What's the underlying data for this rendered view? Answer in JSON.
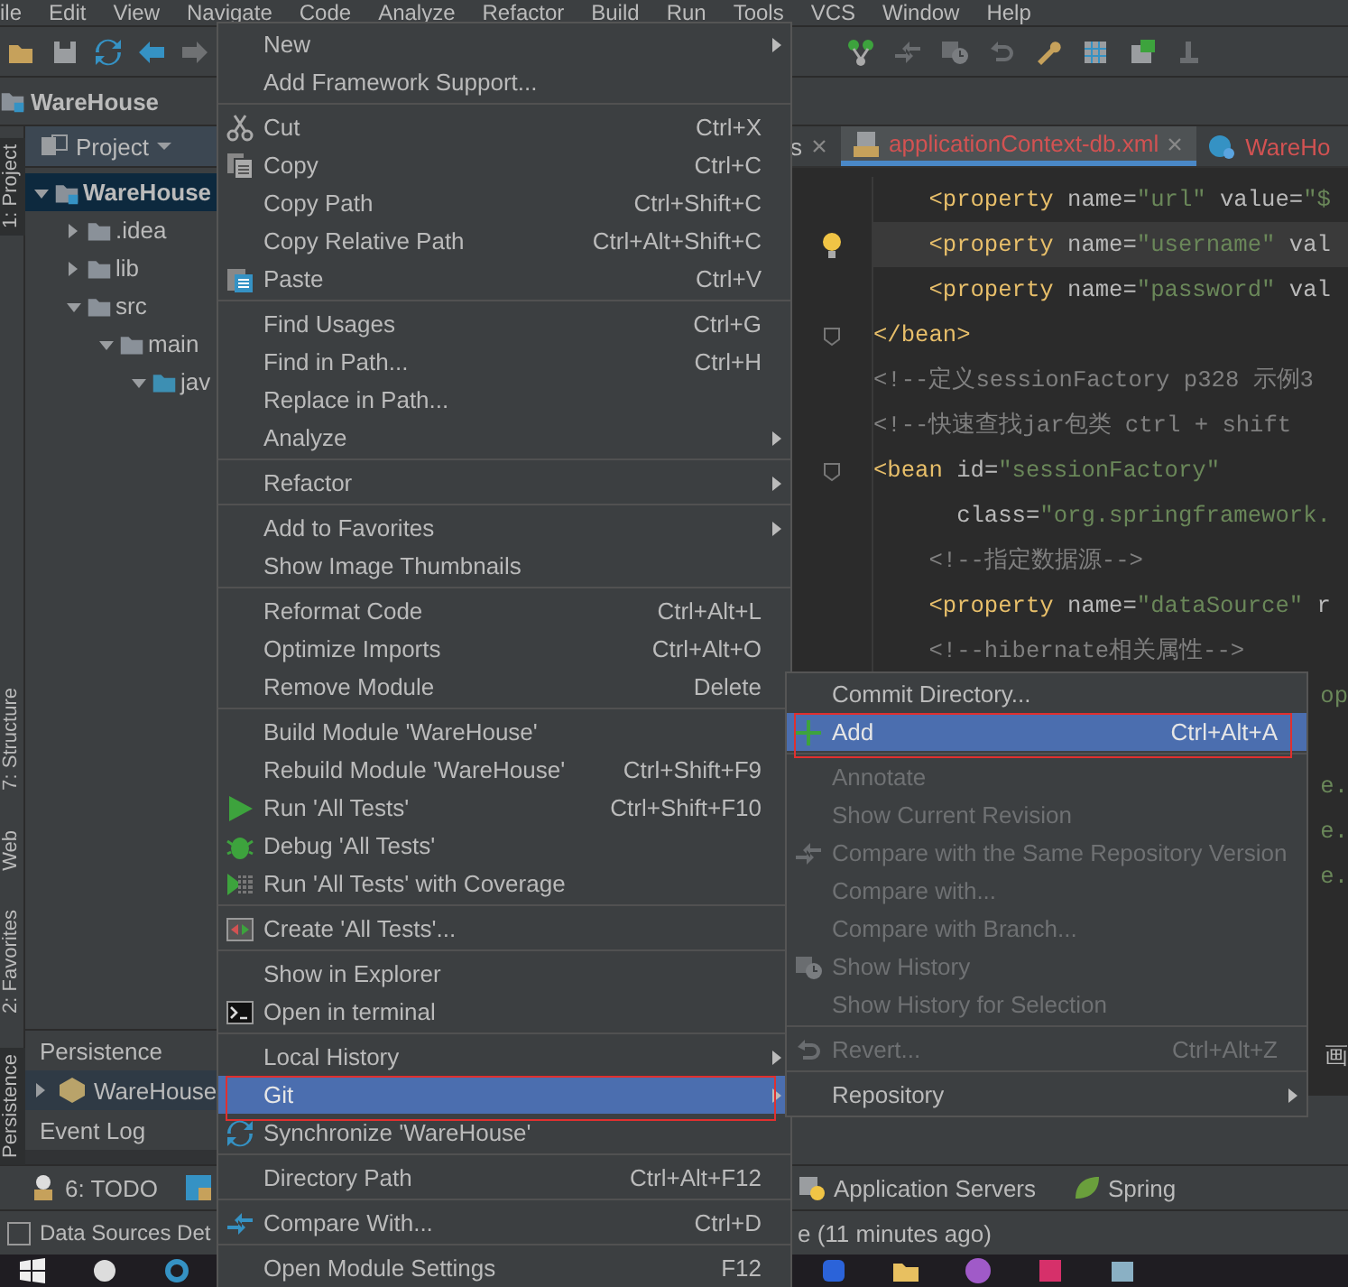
{
  "menu_bar": [
    "ile",
    "Edit",
    "View",
    "Navigate",
    "Code",
    "Analyze",
    "Refactor",
    "Build",
    "Run",
    "Tools",
    "VCS",
    "Window",
    "Help"
  ],
  "breadcrumb": {
    "label": "WareHouse"
  },
  "left_stripe": [
    {
      "label": "1: Project",
      "selected": true
    },
    {
      "label": "7: Structure",
      "selected": false
    },
    {
      "label": "Web",
      "selected": false
    },
    {
      "label": "2: Favorites",
      "selected": false
    },
    {
      "label": "Persistence",
      "selected": true
    }
  ],
  "project_panel": {
    "title": "Project",
    "tree": [
      {
        "label": "WareHouse",
        "expanded": true,
        "selected": true,
        "children": [
          {
            "label": ".idea",
            "expanded": false,
            "selected": false
          },
          {
            "label": "lib",
            "expanded": false,
            "selected": false
          },
          {
            "label": "src",
            "expanded": true,
            "selected": false,
            "children": [
              {
                "label": "main",
                "expanded": true,
                "selected": false,
                "children": [
                  {
                    "label": "jav",
                    "expanded": true,
                    "selected": false
                  }
                ]
              }
            ]
          }
        ]
      }
    ]
  },
  "persistence_panel": {
    "title": "Persistence",
    "items": [
      {
        "label": "WareHouse",
        "expanded": false
      }
    ],
    "footer": "Event Log"
  },
  "editor": {
    "tabs": [
      {
        "label": "s",
        "selected": false
      },
      {
        "label": "applicationContext-db.xml",
        "selected": true
      },
      {
        "label": "WareHo",
        "selected": false
      }
    ],
    "lines": [
      {
        "kind": "code",
        "highlighted": false,
        "tokens": [
          {
            "kind": "tag",
            "text": "    <property"
          },
          {
            "kind": "attr",
            "text": " name="
          },
          {
            "kind": "value",
            "text": "\"url\""
          },
          {
            "kind": "attr",
            "text": " value="
          },
          {
            "kind": "value",
            "text": "\"$"
          }
        ]
      },
      {
        "kind": "code",
        "highlighted": true,
        "tokens": [
          {
            "kind": "tag",
            "text": "    <property"
          },
          {
            "kind": "attr",
            "text": " name="
          },
          {
            "kind": "value",
            "text": "\"username\""
          },
          {
            "kind": "attr",
            "text": " val"
          }
        ]
      },
      {
        "kind": "code",
        "highlighted": false,
        "tokens": [
          {
            "kind": "tag",
            "text": "    <property"
          },
          {
            "kind": "attr",
            "text": " name="
          },
          {
            "kind": "value",
            "text": "\"password\""
          },
          {
            "kind": "attr",
            "text": " val"
          }
        ]
      },
      {
        "kind": "code",
        "highlighted": false,
        "tokens": [
          {
            "kind": "tag",
            "text": "</bean>"
          }
        ]
      },
      {
        "kind": "code",
        "highlighted": false,
        "tokens": [
          {
            "kind": "comment",
            "text": "<!--定义sessionFactory p328 示例3"
          }
        ]
      },
      {
        "kind": "code",
        "highlighted": false,
        "tokens": [
          {
            "kind": "comment",
            "text": "<!--快速查找jar包类 ctrl + shift"
          }
        ]
      },
      {
        "kind": "code",
        "highlighted": false,
        "tokens": [
          {
            "kind": "tag",
            "text": "<bean"
          },
          {
            "kind": "attr",
            "text": " id="
          },
          {
            "kind": "value",
            "text": "\"sessionFactory\""
          }
        ]
      },
      {
        "kind": "code",
        "highlighted": false,
        "tokens": [
          {
            "kind": "attr",
            "text": "      class="
          },
          {
            "kind": "value",
            "text": "\"org.springframework."
          }
        ]
      },
      {
        "kind": "code",
        "highlighted": false,
        "tokens": [
          {
            "kind": "comment",
            "text": "    <!--指定数据源-->"
          }
        ]
      },
      {
        "kind": "code",
        "highlighted": false,
        "tokens": [
          {
            "kind": "tag",
            "text": "    <property"
          },
          {
            "kind": "attr",
            "text": " name="
          },
          {
            "kind": "value",
            "text": "\"dataSource\""
          },
          {
            "kind": "attr",
            "text": " r"
          }
        ]
      },
      {
        "kind": "code",
        "highlighted": false,
        "tokens": [
          {
            "kind": "comment",
            "text": "    <!--hibernate相关属性-->"
          }
        ]
      },
      {
        "kind": "fragment",
        "tokens": [
          {
            "kind": "value",
            "text": "op"
          }
        ]
      },
      {
        "kind": "blank"
      },
      {
        "kind": "fragment",
        "tokens": [
          {
            "kind": "value",
            "text": "e."
          }
        ]
      },
      {
        "kind": "fragment",
        "tokens": [
          {
            "kind": "value",
            "text": "e."
          }
        ]
      },
      {
        "kind": "fragment",
        "tokens": [
          {
            "kind": "value",
            "text": "e."
          }
        ]
      },
      {
        "kind": "blank"
      },
      {
        "kind": "blank"
      },
      {
        "kind": "blank"
      },
      {
        "kind": "fragment",
        "tokens": [
          {
            "kind": "attr",
            "text": "画"
          }
        ]
      }
    ]
  },
  "bottom_tabs": {
    "left": [
      {
        "label": "6: TODO"
      }
    ],
    "right": [
      {
        "label": "Application Servers"
      },
      {
        "label": "Spring"
      }
    ]
  },
  "status_bar": {
    "left": "Data Sources Det",
    "right": "e (11 minutes ago)"
  },
  "context_menu": {
    "items": [
      {
        "kind": "item",
        "label": "New",
        "submenu": true,
        "selected": false
      },
      {
        "kind": "item",
        "label": "Add Framework Support...",
        "selected": false
      },
      {
        "kind": "separator"
      },
      {
        "kind": "item",
        "label": "Cut",
        "shortcut": "Ctrl+X",
        "selected": false
      },
      {
        "kind": "item",
        "label": "Copy",
        "shortcut": "Ctrl+C",
        "selected": false
      },
      {
        "kind": "item",
        "label": "Copy Path",
        "shortcut": "Ctrl+Shift+C",
        "selected": false
      },
      {
        "kind": "item",
        "label": "Copy Relative Path",
        "shortcut": "Ctrl+Alt+Shift+C",
        "selected": false
      },
      {
        "kind": "item",
        "label": "Paste",
        "shortcut": "Ctrl+V",
        "selected": false
      },
      {
        "kind": "separator"
      },
      {
        "kind": "item",
        "label": "Find Usages",
        "shortcut": "Ctrl+G",
        "selected": false
      },
      {
        "kind": "item",
        "label": "Find in Path...",
        "shortcut": "Ctrl+H",
        "selected": false
      },
      {
        "kind": "item",
        "label": "Replace in Path...",
        "selected": false
      },
      {
        "kind": "item",
        "label": "Analyze",
        "submenu": true,
        "selected": false
      },
      {
        "kind": "separator"
      },
      {
        "kind": "item",
        "label": "Refactor",
        "submenu": true,
        "selected": false
      },
      {
        "kind": "separator"
      },
      {
        "kind": "item",
        "label": "Add to Favorites",
        "submenu": true,
        "selected": false
      },
      {
        "kind": "item",
        "label": "Show Image Thumbnails",
        "selected": false
      },
      {
        "kind": "separator"
      },
      {
        "kind": "item",
        "label": "Reformat Code",
        "shortcut": "Ctrl+Alt+L",
        "selected": false
      },
      {
        "kind": "item",
        "label": "Optimize Imports",
        "shortcut": "Ctrl+Alt+O",
        "selected": false
      },
      {
        "kind": "item",
        "label": "Remove Module",
        "shortcut": "Delete",
        "selected": false
      },
      {
        "kind": "separator"
      },
      {
        "kind": "item",
        "label": "Build Module 'WareHouse'",
        "selected": false
      },
      {
        "kind": "item",
        "label": "Rebuild Module 'WareHouse'",
        "shortcut": "Ctrl+Shift+F9",
        "selected": false
      },
      {
        "kind": "item",
        "label": "Run 'All Tests'",
        "shortcut": "Ctrl+Shift+F10",
        "selected": false
      },
      {
        "kind": "item",
        "label": "Debug 'All Tests'",
        "selected": false
      },
      {
        "kind": "item",
        "label": "Run 'All Tests' with Coverage",
        "selected": false
      },
      {
        "kind": "separator"
      },
      {
        "kind": "item",
        "label": "Create 'All Tests'...",
        "selected": false
      },
      {
        "kind": "separator"
      },
      {
        "kind": "item",
        "label": "Show in Explorer",
        "selected": false
      },
      {
        "kind": "item",
        "label": "Open in terminal",
        "selected": false
      },
      {
        "kind": "separator"
      },
      {
        "kind": "item",
        "label": "Local History",
        "submenu": true,
        "selected": false
      },
      {
        "kind": "item",
        "label": "Git",
        "submenu": true,
        "selected": true,
        "annotated": true
      },
      {
        "kind": "item",
        "label": "Synchronize 'WareHouse'",
        "selected": false
      },
      {
        "kind": "separator"
      },
      {
        "kind": "item",
        "label": "Directory Path",
        "shortcut": "Ctrl+Alt+F12",
        "selected": false
      },
      {
        "kind": "separator"
      },
      {
        "kind": "item",
        "label": "Compare With...",
        "shortcut": "Ctrl+D",
        "selected": false
      },
      {
        "kind": "separator"
      },
      {
        "kind": "item",
        "label": "Open Module Settings",
        "shortcut": "F12",
        "selected": false
      }
    ]
  },
  "git_submenu": {
    "items": [
      {
        "kind": "item",
        "label": "Commit Directory...",
        "selected": false,
        "disabled": false
      },
      {
        "kind": "item",
        "label": "Add",
        "shortcut": "Ctrl+Alt+A",
        "selected": true,
        "disabled": false,
        "annotated": true
      },
      {
        "kind": "separator"
      },
      {
        "kind": "item",
        "label": "Annotate",
        "selected": false,
        "disabled": true
      },
      {
        "kind": "item",
        "label": "Show Current Revision",
        "selected": false,
        "disabled": true
      },
      {
        "kind": "item",
        "label": "Compare with the Same Repository Version",
        "selected": false,
        "disabled": true
      },
      {
        "kind": "item",
        "label": "Compare with...",
        "selected": false,
        "disabled": true
      },
      {
        "kind": "item",
        "label": "Compare with Branch...",
        "selected": false,
        "disabled": true
      },
      {
        "kind": "item",
        "label": "Show History",
        "selected": false,
        "disabled": true
      },
      {
        "kind": "item",
        "label": "Show History for Selection",
        "selected": false,
        "disabled": true
      },
      {
        "kind": "separator"
      },
      {
        "kind": "item",
        "label": "Revert...",
        "shortcut": "Ctrl+Alt+Z",
        "selected": false,
        "disabled": true
      },
      {
        "kind": "separator"
      },
      {
        "kind": "item",
        "label": "Repository",
        "submenu": true,
        "selected": false,
        "disabled": false
      }
    ]
  }
}
